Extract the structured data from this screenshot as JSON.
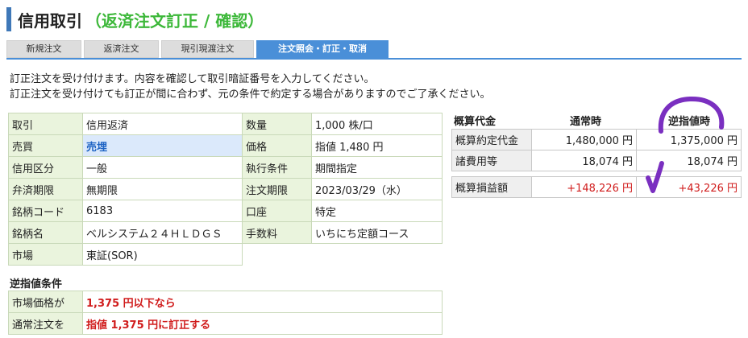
{
  "header": {
    "title": "信用取引",
    "subtitle": "（返済注文訂正 / 確認）"
  },
  "tabs": [
    {
      "label": "新規注文"
    },
    {
      "label": "返済注文"
    },
    {
      "label": "現引現渡注文"
    },
    {
      "label": "注文照会・訂正・取消",
      "active": true
    }
  ],
  "notice": {
    "line1": "訂正注文を受け付けます。内容を確認して取引暗証番号を入力してください。",
    "line2": "訂正注文を受け付けても訂正が間に合わず、元の条件で約定する場合がありますのでご了承ください。"
  },
  "order": {
    "rows": [
      {
        "l1": "取引",
        "v1": "信用返済",
        "l2": "数量",
        "v2": "1,000 株/口"
      },
      {
        "l1": "売買",
        "v1": "売埋",
        "l2": "価格",
        "v2": "指値 1,480 円"
      },
      {
        "l1": "信用区分",
        "v1": "一般",
        "l2": "執行条件",
        "v2": "期間指定"
      },
      {
        "l1": "弁済期限",
        "v1": "無期限",
        "l2": "注文期限",
        "v2": "2023/03/29（水）"
      },
      {
        "l1": "銘柄コード",
        "v1": "6183",
        "l2": "口座",
        "v2": "特定"
      },
      {
        "l1": "銘柄名",
        "v1": "ベルシステム２４ＨＬＤＧＳ",
        "l2": "手数料",
        "v2": "いちにち定額コース"
      },
      {
        "l1": "市場",
        "v1": "東証(SOR)"
      }
    ]
  },
  "stop_conditions": {
    "title": "逆指値条件",
    "rows": [
      {
        "label": "市場価格が",
        "value": "1,375 円以下なら"
      },
      {
        "label": "通常注文を",
        "value": "指値 1,375 円に訂正する"
      }
    ]
  },
  "estimate": {
    "title": "概算代金",
    "col_normal": "通常時",
    "col_stop": "逆指値時",
    "rows": [
      {
        "label": "概算約定代金",
        "normal": "1,480,000 円",
        "stop": "1,375,000 円"
      },
      {
        "label": "諸費用等",
        "normal": "18,074 円",
        "stop": "18,074 円"
      }
    ],
    "pl": {
      "label": "概算損益額",
      "normal": "+148,226 円",
      "stop": "+43,226 円"
    }
  },
  "colors": {
    "accent": "#4a8fd8",
    "green": "#3db83a",
    "red": "#d01c1c",
    "marker": "#7a2fc0"
  }
}
